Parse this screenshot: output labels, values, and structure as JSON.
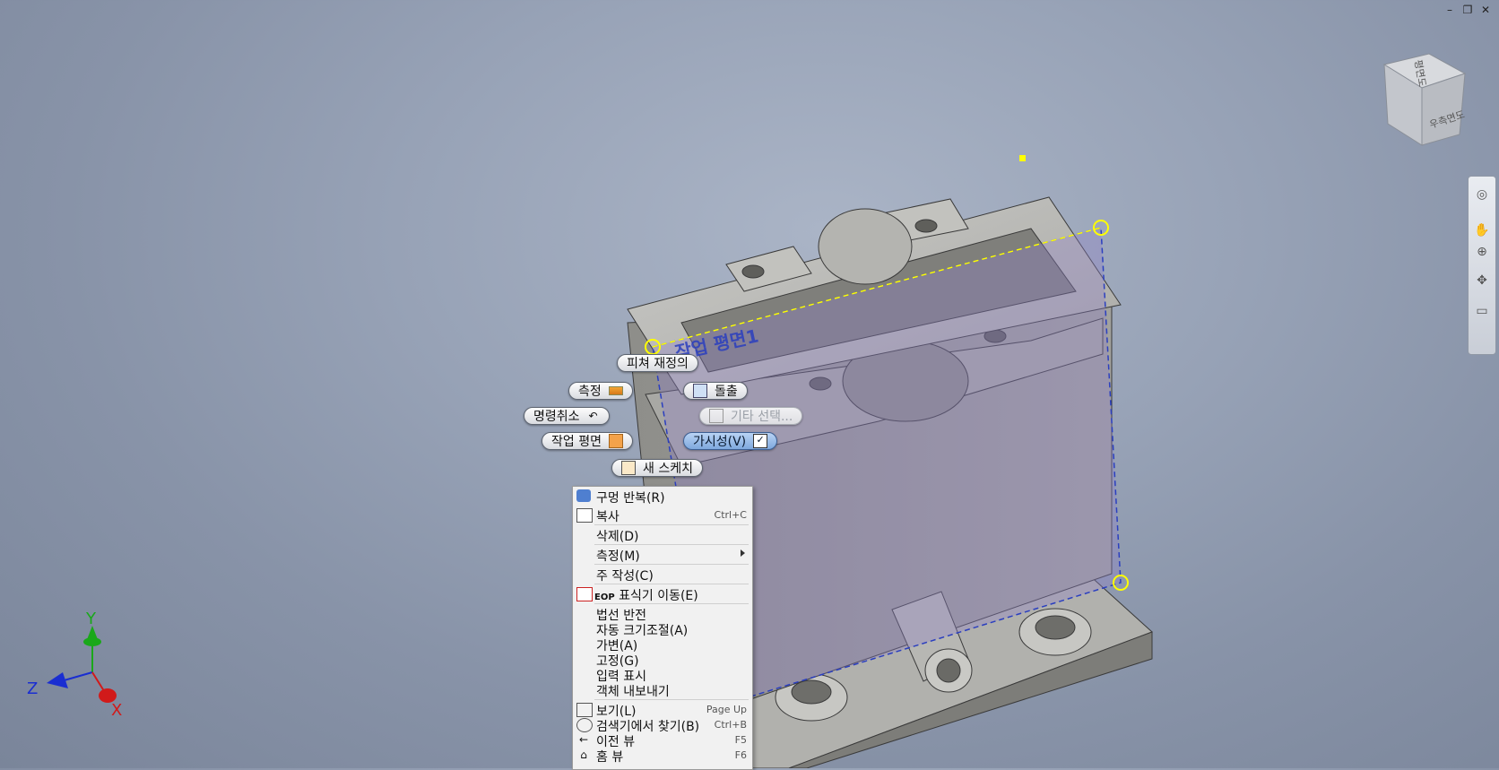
{
  "window_controls": [
    "–",
    "❐",
    "✕"
  ],
  "viewcube": {
    "top_face": "평면도",
    "right_face": "우측면도"
  },
  "model": {
    "work_plane_label": "작업 평면1"
  },
  "marking_menu": {
    "redefine_feature": "피쳐 재정의",
    "measure": "측정",
    "extrude": "돌출",
    "undo": "명령취소",
    "other_select": "기타 선택...",
    "work_plane": "작업 평면",
    "visibility": "가시성(V)",
    "new_sketch": "새 스케치"
  },
  "context_menu": {
    "items": [
      {
        "label": "구멍 반복(R)",
        "shortcut": ""
      },
      {
        "label": "복사",
        "shortcut": "Ctrl+C"
      },
      {
        "label": "삭제(D)",
        "shortcut": ""
      },
      {
        "label": "측정(M)",
        "shortcut": ""
      },
      {
        "label": "주 작성(C)",
        "shortcut": ""
      },
      {
        "label_prefix": "EOP",
        "label": "표식기 이동(E)",
        "shortcut": ""
      },
      {
        "label": "법선 반전",
        "shortcut": ""
      },
      {
        "label": "자동 크기조절(A)",
        "shortcut": ""
      },
      {
        "label": "가변(A)",
        "shortcut": ""
      },
      {
        "label": "고정(G)",
        "shortcut": ""
      },
      {
        "label": "입력 표시",
        "shortcut": ""
      },
      {
        "label": "객체 내보내기",
        "shortcut": ""
      },
      {
        "label": "보기(L)",
        "shortcut": "Page Up"
      },
      {
        "label": "검색기에서 찾기(B)",
        "shortcut": "Ctrl+B"
      },
      {
        "label": "이전 뷰",
        "shortcut": "F5"
      },
      {
        "label": "홈 뷰",
        "shortcut": "F6"
      }
    ]
  },
  "triad": {
    "x": "X",
    "y": "Y",
    "z": "Z"
  },
  "colors": {
    "axis_x": "#d11a1a",
    "axis_y": "#1aa81a",
    "axis_z": "#1a2ed1",
    "plane": "#8f82c8",
    "selection": "#ffff00"
  }
}
